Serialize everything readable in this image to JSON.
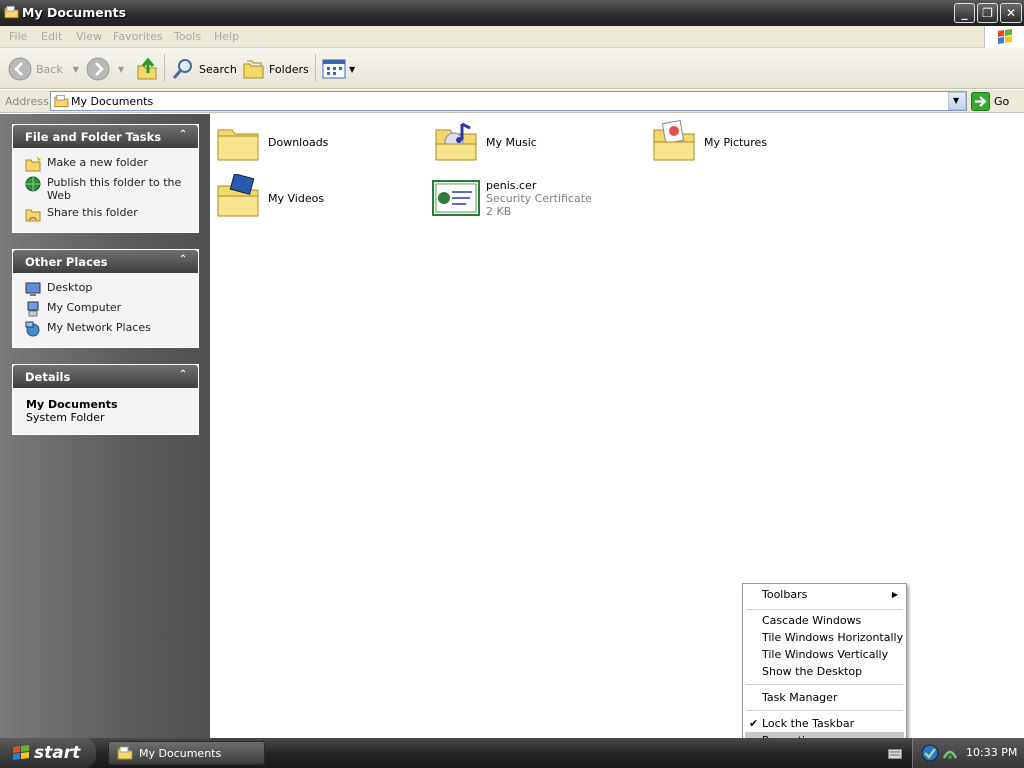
{
  "window": {
    "title": "My Documents"
  },
  "menu": [
    "File",
    "Edit",
    "View",
    "Favorites",
    "Tools",
    "Help"
  ],
  "toolbar": {
    "back": "Back",
    "search": "Search",
    "folders": "Folders"
  },
  "address": {
    "label": "Address",
    "value": "My Documents",
    "go": "Go"
  },
  "panels": {
    "tasks": {
      "title": "File and Folder Tasks",
      "items": [
        "Make a new folder",
        "Publish this folder to the Web",
        "Share this folder"
      ]
    },
    "places": {
      "title": "Other Places",
      "items": [
        "Desktop",
        "My Computer",
        "My Network Places"
      ]
    },
    "details": {
      "title": "Details",
      "name": "My Documents",
      "type": "System Folder"
    }
  },
  "files": [
    {
      "name": "Downloads",
      "icon": "folder-icon"
    },
    {
      "name": "My Music",
      "icon": "music-folder-icon"
    },
    {
      "name": "My Pictures",
      "icon": "pictures-folder-icon"
    },
    {
      "name": "My Videos",
      "icon": "videos-folder-icon"
    },
    {
      "name": "penis.cer",
      "type": "Security Certificate",
      "size": "2 KB",
      "icon": "certificate-icon"
    }
  ],
  "context_menu": {
    "toolbars": "Toolbars",
    "cascade": "Cascade Windows",
    "tile_h": "Tile Windows Horizontally",
    "tile_v": "Tile Windows Vertically",
    "show_desktop": "Show the Desktop",
    "task_manager": "Task Manager",
    "lock": "Lock the Taskbar",
    "properties": "Properties"
  },
  "taskbar": {
    "start": "start",
    "window": "My Documents",
    "clock": "10:33 PM"
  },
  "colors": {
    "folder": "#f3d86b",
    "accent": "#3a3a3a",
    "highlight": "#c8c8c8"
  }
}
